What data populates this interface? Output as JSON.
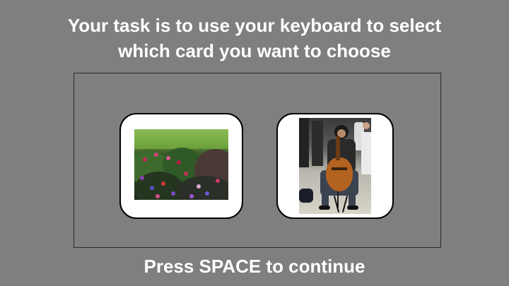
{
  "instruction": {
    "line1": "Your task is to use your keyboard to select",
    "line2": "which card you want to choose"
  },
  "cards": [
    {
      "image": "flowers-garden-photo"
    },
    {
      "image": "cellist-playing-photo"
    }
  ],
  "footer": {
    "continue_text": "Press SPACE to continue"
  },
  "colors": {
    "background": "#7f7f7f",
    "text": "#ffffff",
    "card": "#ffffff",
    "frame": "#2b2b2b"
  }
}
